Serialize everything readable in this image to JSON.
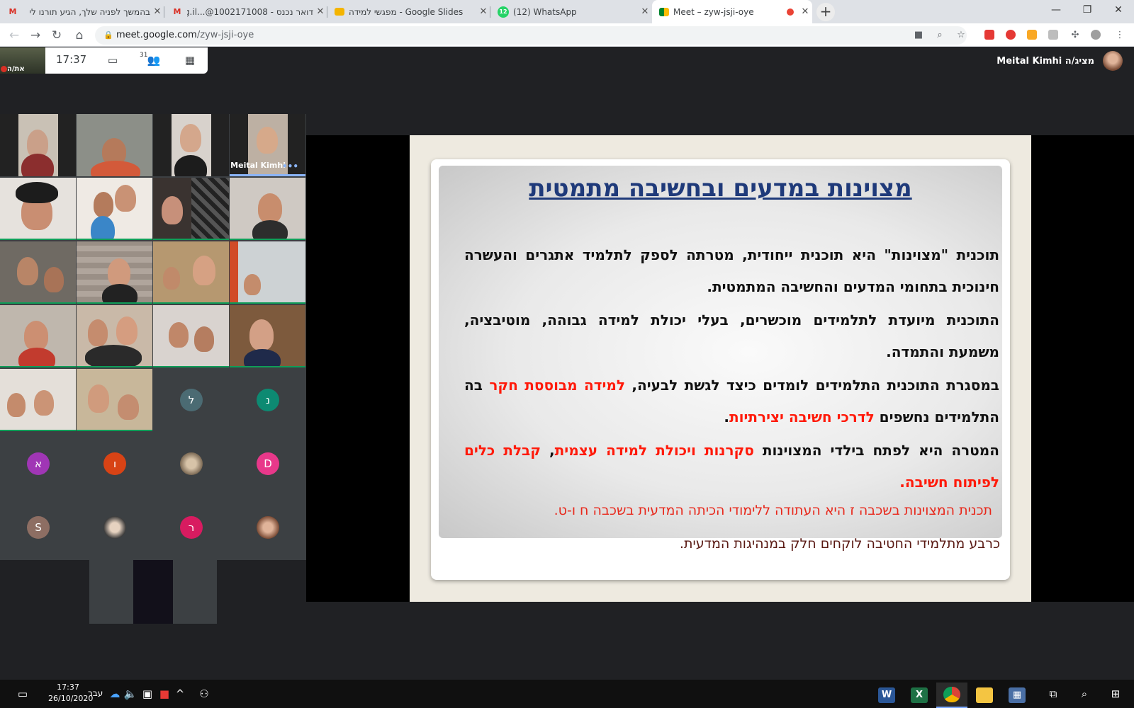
{
  "browser": {
    "tabs": [
      {
        "title": "בהמשך לפניה שלך, הגיע תורנו לי",
        "icon": "gmail-icon"
      },
      {
        "title": "דואר נכנס - 1002171008@...org.il",
        "icon": "gmail-icon"
      },
      {
        "title": "מפגשי למידה - Google Slides",
        "icon": "slides-icon"
      },
      {
        "title": "(12) WhatsApp",
        "icon": "whatsapp-icon",
        "badge": "12"
      },
      {
        "title": "Meet – zyw-jsji-oye",
        "icon": "meet-icon",
        "active": true
      }
    ],
    "new_tab": "+",
    "url_host": "meet.google.com",
    "url_path": "/zyw-jsji-oye",
    "window_controls": [
      "—",
      "❐",
      "✕"
    ]
  },
  "meet": {
    "self_label": "את/ה",
    "time": "17:37",
    "people_count": "31",
    "presenter": "Meital Kimhi מציג/ה",
    "tiles_named": [
      {
        "name": "Meital Kimhi",
        "dots": "•••"
      }
    ],
    "avatars": [
      {
        "letter": "ל",
        "color": "#4b6b73"
      },
      {
        "letter": "נ",
        "color": "#0d8a72"
      },
      {
        "letter": "א",
        "color": "#a036b5"
      },
      {
        "letter": "ו",
        "color": "#d84315"
      },
      {
        "letter": "D",
        "color": "#e8388a"
      },
      {
        "letter": "S",
        "color": "#8d6e63"
      },
      {
        "letter": "ר",
        "color": "#d81b60"
      }
    ]
  },
  "slide": {
    "title": "מצוינות במדעים ובחשיבה מתמטית",
    "p1": "תוכנית \"מצוינות\" היא תוכנית ייחודית, מטרתה לספק לתלמיד אתגרים והעשרה חינוכית בתחומי המדעים והחשיבה המתמטית.",
    "p2": "התוכנית מיועדת לתלמידים מוכשרים, בעלי יכולת למידה גבוהה, מוטיבציה, משמעת והתמדה.",
    "p3a": "במסגרת התוכנית התלמידים לומדים כיצד לגשת לבעיה,",
    "p3b": "למידה מבוססת חקר",
    "p3c": "בה התלמידים נחשפים",
    "p3d": "לדרכי חשיבה יצירתיות",
    "p4a": "המטרה היא לפתח בילדי המצוינות",
    "p4b": "סקרנות ויכולת למידה עצמית",
    "p4c": "קבלת כלים לפיתוח חשיבה.",
    "line5": "תכנית המצוינות בשכבה ז היא העתודה ללימודי הכיתה המדעית בשכבה ח ו-ט.",
    "line6": "כרבע מתלמידי החטיבה לוקחים חלק במנהיגות המדעית."
  },
  "taskbar": {
    "time": "17:37",
    "date": "26/10/2020",
    "lang": "עבר",
    "apps": [
      "Word",
      "Excel",
      "Chrome",
      "File Explorer",
      "Calculator"
    ]
  }
}
